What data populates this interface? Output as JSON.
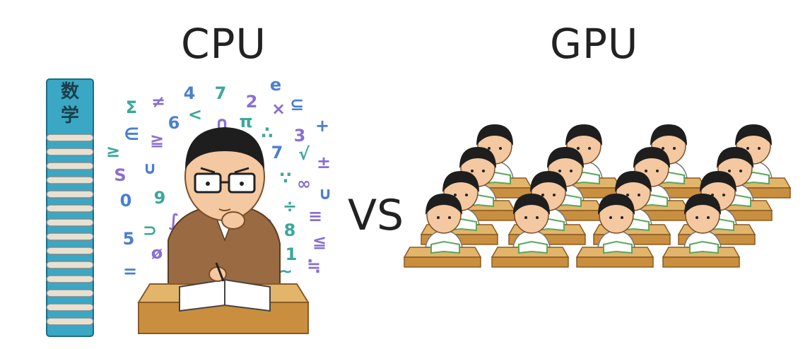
{
  "titles": {
    "cpu": "CPU",
    "gpu": "GPU",
    "vs": "VS"
  },
  "book": {
    "label_1": "数",
    "label_2": "学"
  },
  "math_symbols": [
    "4",
    "7",
    "2",
    "e",
    "Σ",
    "≠",
    "6",
    "<",
    "∩",
    "⊆",
    "π",
    "×",
    "∈",
    "∴",
    "3",
    "+",
    "≥",
    "≧",
    "7",
    "√",
    "S",
    "∪",
    "∵",
    "±",
    "0",
    "9",
    "∞",
    "∪",
    "÷",
    "≡",
    "5",
    "⊃",
    "∫",
    "∞",
    "8",
    "ø",
    "i",
    "1",
    "≦",
    "=",
    "~",
    "≒"
  ],
  "colors": {
    "book_cover": "#3aa7c4",
    "book_pages": "#e8e0d0",
    "desk_top": "#e3b56b",
    "desk_front": "#c98f3f",
    "jacket": "#9a6b43",
    "hair": "#1e1e1e",
    "skin": "#f4c8a0",
    "student_shirt": "#ffffff",
    "notebook": "#58a85a",
    "sym_blue": "#4a7fd1",
    "sym_teal": "#3aa89a",
    "sym_purple": "#8a6fd1"
  }
}
